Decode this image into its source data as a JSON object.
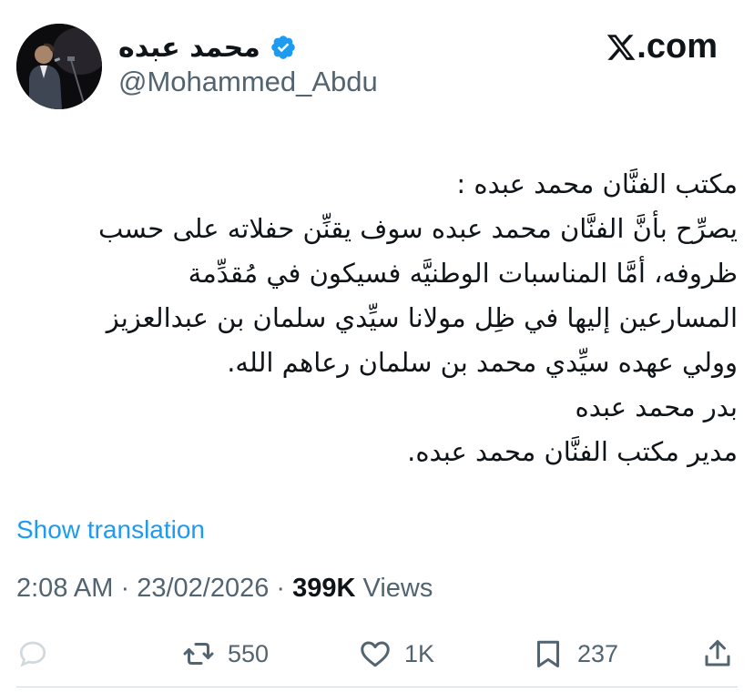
{
  "user": {
    "display_name": "محمد عبده",
    "handle": "@Mohammed_Abdu",
    "verified": true,
    "verified_color": "#1d9bf0"
  },
  "brand": {
    "logo_text": ".com",
    "logo_icon": "x-logo-icon"
  },
  "tweet": {
    "lines": [
      "مكتب الفنَّان محمد عبده :",
      "يصرِّح بأنَّ الفنَّان محمد عبده سوف يقنِّن حفلاته على حسب",
      "ظروفه، أمَّا المناسبات الوطنيَّه فسيكون في مُقدِّمة",
      "المسارعين إليها في ظِل مولانا سيِّدي سلمان بن عبدالعزيز",
      "وولي عهده سيِّدي محمد بن سلمان رعاهم الله.",
      "بدر محمد عبده",
      "مدير مكتب الفنَّان محمد عبده."
    ],
    "show_translation": "Show translation",
    "time": "2:08 AM",
    "date": "23/02/2026",
    "views_count": "399K",
    "views_label": "Views"
  },
  "actions": {
    "reply": {
      "icon": "reply-icon",
      "count": ""
    },
    "retweet": {
      "icon": "retweet-icon",
      "count": "550"
    },
    "like": {
      "icon": "heart-icon",
      "count": "1K"
    },
    "bookmark": {
      "icon": "bookmark-icon",
      "count": "237"
    },
    "share": {
      "icon": "share-icon",
      "count": ""
    }
  },
  "colors": {
    "text": "#0f1419",
    "secondary": "#536471",
    "accent": "#1d9bf0",
    "divider": "#cfd9de"
  }
}
